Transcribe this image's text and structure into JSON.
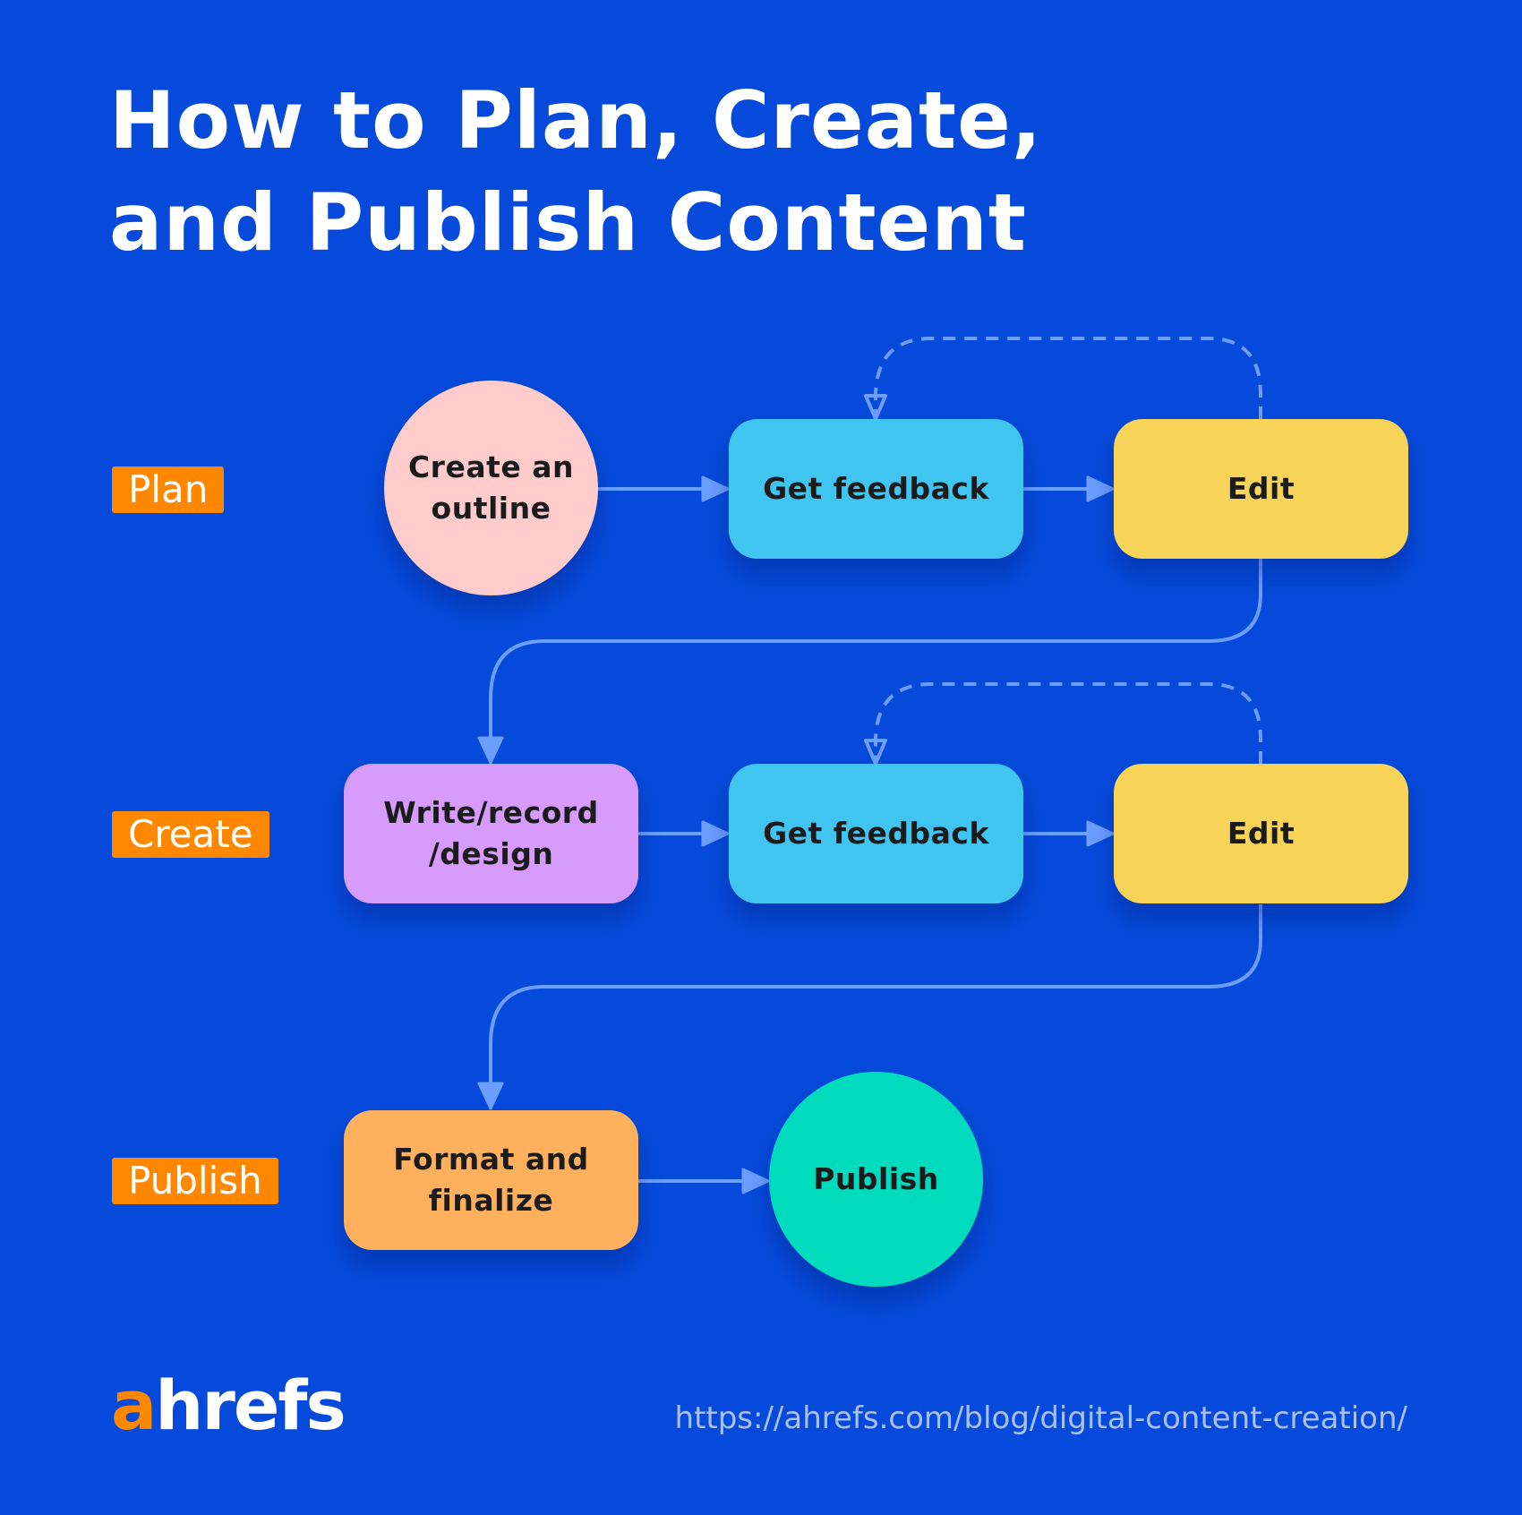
{
  "title": {
    "line1": "How to Plan, Create,",
    "line2": "and Publish Content"
  },
  "stages": [
    {
      "id": "plan",
      "label": "Plan"
    },
    {
      "id": "create",
      "label": "Create"
    },
    {
      "id": "publish",
      "label": "Publish"
    }
  ],
  "nodes": [
    {
      "id": "outline",
      "stage": "plan",
      "shape": "blob",
      "label_lines": [
        "Create an",
        "outline"
      ],
      "color": "#FFCCCB"
    },
    {
      "id": "feedback1",
      "stage": "plan",
      "shape": "rect",
      "label_lines": [
        "Get feedback"
      ],
      "color": "#40C4F0"
    },
    {
      "id": "edit1",
      "stage": "plan",
      "shape": "rect",
      "label_lines": [
        "Edit"
      ],
      "color": "#F7D358"
    },
    {
      "id": "write",
      "stage": "create",
      "shape": "rect",
      "label_lines": [
        "Write/record",
        "/design"
      ],
      "color": "#D69BFB"
    },
    {
      "id": "feedback2",
      "stage": "create",
      "shape": "rect",
      "label_lines": [
        "Get feedback"
      ],
      "color": "#40C4F0"
    },
    {
      "id": "edit2",
      "stage": "create",
      "shape": "rect",
      "label_lines": [
        "Edit"
      ],
      "color": "#F7D358"
    },
    {
      "id": "format",
      "stage": "publish",
      "shape": "rect",
      "label_lines": [
        "Format and",
        "finalize"
      ],
      "color": "#FFB05C"
    },
    {
      "id": "publish",
      "stage": "publish",
      "shape": "blob",
      "label_lines": [
        "Publish"
      ],
      "color": "#00DBBE"
    }
  ],
  "edges": [
    {
      "from": "outline",
      "to": "feedback1",
      "style": "solid"
    },
    {
      "from": "feedback1",
      "to": "edit1",
      "style": "solid"
    },
    {
      "from": "edit1",
      "to": "feedback1",
      "style": "dashed"
    },
    {
      "from": "edit1",
      "to": "write",
      "style": "solid"
    },
    {
      "from": "write",
      "to": "feedback2",
      "style": "solid"
    },
    {
      "from": "feedback2",
      "to": "edit2",
      "style": "solid"
    },
    {
      "from": "edit2",
      "to": "feedback2",
      "style": "dashed"
    },
    {
      "from": "edit2",
      "to": "format",
      "style": "solid"
    },
    {
      "from": "format",
      "to": "publish",
      "style": "solid"
    }
  ],
  "colors": {
    "background": "#054ADA",
    "stage_badge": "#FF8800",
    "connector": "#6B9EFF"
  },
  "footer": {
    "logo_accent": "a",
    "logo_rest": "hrefs",
    "url": "https://ahrefs.com/blog/digital-content-creation/"
  }
}
